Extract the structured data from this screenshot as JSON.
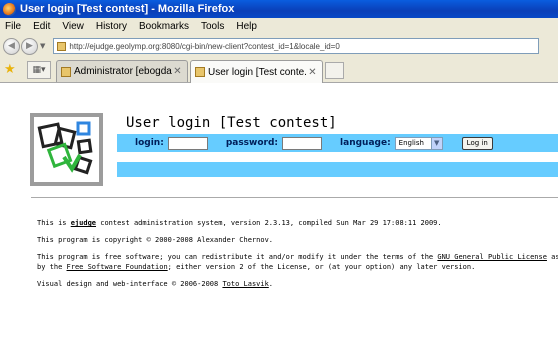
{
  "window": {
    "title": "User login [Test contest] - Mozilla Firefox"
  },
  "menu": [
    "File",
    "Edit",
    "View",
    "History",
    "Bookmarks",
    "Tools",
    "Help"
  ],
  "nav": {
    "url": "http://ejudge.geolymp.org:8080/cgi-bin/new-client?contest_id=1&locale_id=0"
  },
  "tabs": [
    {
      "label": "Administrator [ebogda...",
      "active": false
    },
    {
      "label": "User login [Test conte...",
      "active": true
    }
  ],
  "page": {
    "title": "User login [Test contest]",
    "login_label": "login:",
    "password_label": "password:",
    "language_label": "language:",
    "language_value": "English",
    "login_button": "Log in",
    "footer": {
      "line1_pre": "This is ",
      "line1_link": "ejudge",
      "line1_post": " contest administration system, version 2.3.13, compiled Sun Mar 29 17:08:11 2009.",
      "line2": "This program is copyright © 2000-2008 Alexander Chernov.",
      "line3_pre": "This program is free software; you can redistribute it and/or modify it under the terms of the ",
      "line3_link": "GNU General Public License",
      "line3_post": " as p",
      "line4_pre": "by the ",
      "line4_link": "Free Software Foundation",
      "line4_post": "; either version 2 of the License, or (at your option) any later version.",
      "line5_pre": "Visual design and web-interface © 2006-2008 ",
      "line5_link": "Toto Lasvik",
      "line5_post": "."
    }
  }
}
